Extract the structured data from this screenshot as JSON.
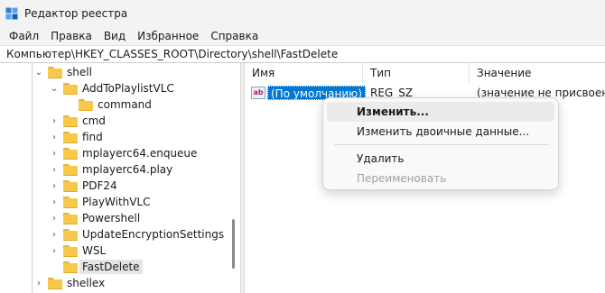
{
  "window": {
    "title": "Редактор реестра",
    "icon": "regedit-icon"
  },
  "menubar": {
    "items": [
      "Файл",
      "Правка",
      "Вид",
      "Избранное",
      "Справка"
    ]
  },
  "address": {
    "path": "Компьютер\\HKEY_CLASSES_ROOT\\Directory\\shell\\FastDelete"
  },
  "tree": {
    "items": [
      {
        "label": "shell",
        "expanded": true
      },
      {
        "label": "AddToPlaylistVLC",
        "expanded": true
      },
      {
        "label": "command"
      },
      {
        "label": "cmd"
      },
      {
        "label": "find"
      },
      {
        "label": "mplayerc64.enqueue"
      },
      {
        "label": "mplayerc64.play"
      },
      {
        "label": "PDF24"
      },
      {
        "label": "PlayWithVLC"
      },
      {
        "label": "Powershell"
      },
      {
        "label": "UpdateEncryptionSettings"
      },
      {
        "label": "WSL"
      },
      {
        "label": "FastDelete",
        "selected": true
      },
      {
        "label": "shellex"
      }
    ]
  },
  "values": {
    "columns": {
      "name": "Имя",
      "type": "Тип",
      "data": "Значение"
    },
    "rows": [
      {
        "icon": "ab",
        "name": "(По умолчанию)",
        "type": "REG_SZ",
        "data": "(значение не присвоено)"
      }
    ]
  },
  "context_menu": {
    "items": [
      {
        "label": "Изменить...",
        "state": "hover"
      },
      {
        "label": "Изменить двоичные данные..."
      },
      {
        "label": "Удалить"
      },
      {
        "label": "Переименовать",
        "state": "disabled"
      }
    ]
  },
  "colors": {
    "selection": "#0078d4",
    "folder": "#f6c94b",
    "chrome": "#f3f3f3"
  }
}
